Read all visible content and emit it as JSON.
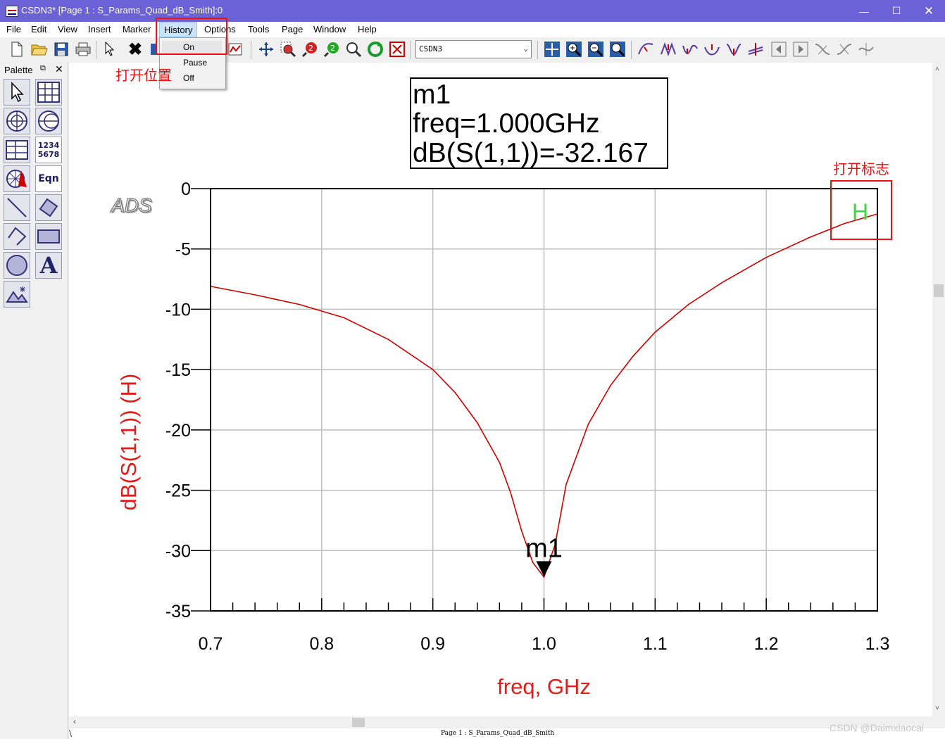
{
  "window": {
    "title": "CSDN3* [Page 1 : S_Params_Quad_dB_Smith]:0"
  },
  "menubar": {
    "items": [
      "File",
      "Edit",
      "View",
      "Insert",
      "Marker",
      "History",
      "Options",
      "Tools",
      "Page",
      "Window",
      "Help"
    ]
  },
  "history_menu": {
    "items": [
      "On",
      "Pause",
      "Off"
    ]
  },
  "toolbar": {
    "design_select": "CSDN3"
  },
  "palette": {
    "title": "Palette",
    "labels": {
      "numbers_top": "1234",
      "numbers_bottom": "5678",
      "eqn": "Eqn",
      "text": "A"
    }
  },
  "annotations": {
    "menu_location": "打开位置",
    "open_marker": "打开标志",
    "history_mark": "H",
    "logo": "ADS"
  },
  "marker": {
    "name": "m1",
    "freq_line": "freq=1.000GHz",
    "value_line": "dB(S(1,1))=-32.167",
    "label": "m1"
  },
  "status": {
    "page": "Page 1 : S_Params_Quad_dB_Smith",
    "watermark": "CSDN @Daimxiaocai"
  },
  "chart_data": {
    "type": "line",
    "xlabel": "freq, GHz",
    "ylabel": "dB(S(1,1))  (H)",
    "xlim": [
      0.7,
      1.3
    ],
    "ylim": [
      -35,
      0
    ],
    "xticks": [
      "0.7",
      "0.8",
      "0.9",
      "1.0",
      "1.1",
      "1.2",
      "1.3"
    ],
    "yticks": [
      "0",
      "-5",
      "-10",
      "-15",
      "-20",
      "-25",
      "-30",
      "-35"
    ],
    "grid": true,
    "series": [
      {
        "color": "#d00000",
        "x": [
          0.7,
          0.74,
          0.78,
          0.82,
          0.86,
          0.9,
          0.92,
          0.94,
          0.96,
          0.97,
          0.98,
          0.99,
          1.0,
          1.01,
          1.02,
          1.04,
          1.06,
          1.08,
          1.1,
          1.13,
          1.16,
          1.2,
          1.24,
          1.27,
          1.3
        ],
        "y": [
          -8.1,
          -8.8,
          -9.6,
          -10.7,
          -12.5,
          -15.0,
          -16.9,
          -19.4,
          -22.7,
          -25.2,
          -28.4,
          -31.0,
          -32.2,
          -29.5,
          -24.5,
          -19.5,
          -16.3,
          -13.9,
          -11.9,
          -9.6,
          -7.8,
          -5.7,
          -4.0,
          -2.9,
          -2.1
        ]
      }
    ],
    "marker": {
      "x": 1.0,
      "y": -32.167
    }
  }
}
